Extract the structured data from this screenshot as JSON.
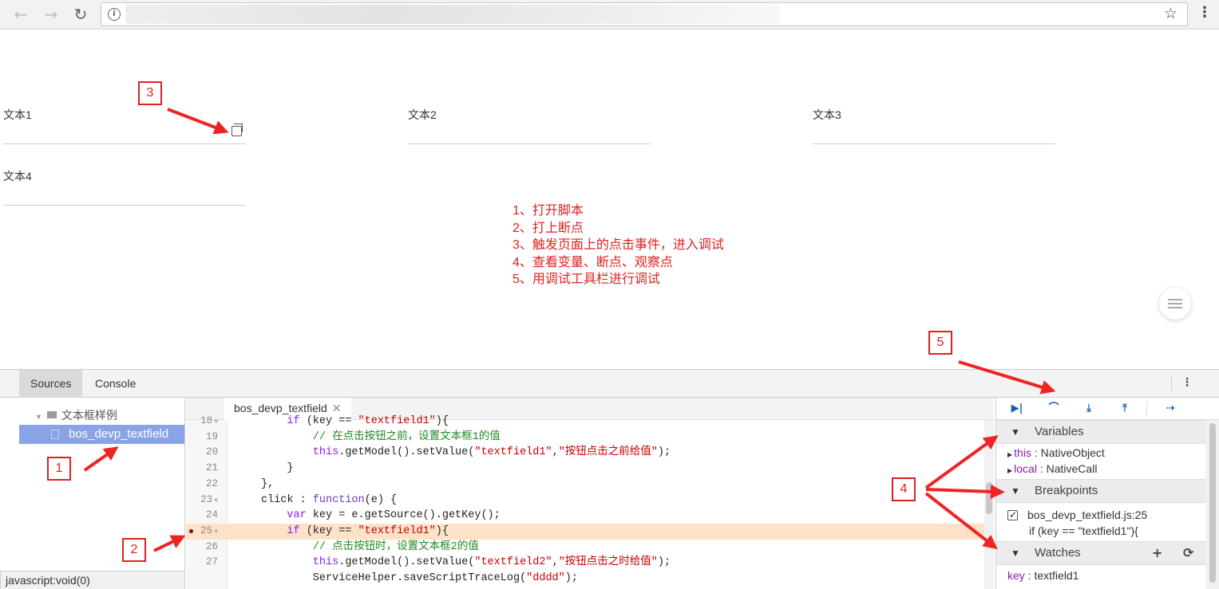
{
  "browser": {
    "back_icon": "arrow-left-icon",
    "forward_icon": "arrow-right-icon",
    "reload_icon": "reload-icon",
    "star_icon": "star-icon",
    "menu_icon": "vertical-dots-icon"
  },
  "page": {
    "fields": [
      {
        "label": "文本1"
      },
      {
        "label": "文本2"
      },
      {
        "label": "文本3"
      },
      {
        "label": "文本4"
      }
    ],
    "steps": [
      "1、打开脚本",
      "2、打上断点",
      "3、触发页面上的点击事件，进入调试",
      "4、查看变量、断点、观察点",
      "5、用调试工具栏进行调试"
    ]
  },
  "callouts": [
    "1",
    "2",
    "3",
    "4",
    "5"
  ],
  "colors": {
    "annotation": "#e02020",
    "selected_file": "#88a4e4",
    "highlight_line": "#fde2c8"
  },
  "devtools": {
    "tabs": [
      "Sources",
      "Console"
    ],
    "active_tab": "Sources",
    "navigator": {
      "folder": "文本框样例",
      "file": "bos_devp_textfield"
    },
    "editor_tab": "bos_devp_textfield",
    "code_lines": [
      {
        "n": "18",
        "fold": true,
        "text": "        if (key == \"textfield1\"){"
      },
      {
        "n": "19",
        "text": "            // 在点击按钮之前，设置文本框1的值"
      },
      {
        "n": "20",
        "text": "            this.getModel().setValue(\"textfield1\",\"按钮点击之前给值\");"
      },
      {
        "n": "21",
        "text": "        }"
      },
      {
        "n": "22",
        "text": "    },"
      },
      {
        "n": "23",
        "fold": true,
        "text": "    click : function(e) {"
      },
      {
        "n": "24",
        "text": "        var key = e.getSource().getKey();"
      },
      {
        "n": "25",
        "fold": true,
        "breakpoint": true,
        "highlight": true,
        "text": "        if (key == \"textfield1\"){"
      },
      {
        "n": "26",
        "text": "            // 点击按钮时，设置文本框2的值"
      },
      {
        "n": "27",
        "text": "            this.getModel().setValue(\"textfield2\",\"按钮点击之时给值\");"
      },
      {
        "n": "",
        "text": "            ServiceHelper.saveScriptTraceLog(\"dddd\");"
      }
    ],
    "status_text": "javascript:void(0)",
    "debugger_toolbar": [
      "resume-icon",
      "step-over-icon",
      "step-into-icon",
      "step-out-icon",
      "deactivate-breakpoints-icon"
    ],
    "variables": {
      "title": "Variables",
      "items": [
        {
          "name": "this",
          "value": "NativeObject"
        },
        {
          "name": "local",
          "value": "NativeCall"
        }
      ]
    },
    "breakpoints": {
      "title": "Breakpoints",
      "location": "bos_devp_textfield.js:25",
      "snippet": "if (key == \"textfield1\"){"
    },
    "watches": {
      "title": "Watches",
      "add_label": "+",
      "refresh_label": "⟳",
      "items": [
        {
          "name": "key",
          "value": "textfield1"
        }
      ]
    }
  }
}
